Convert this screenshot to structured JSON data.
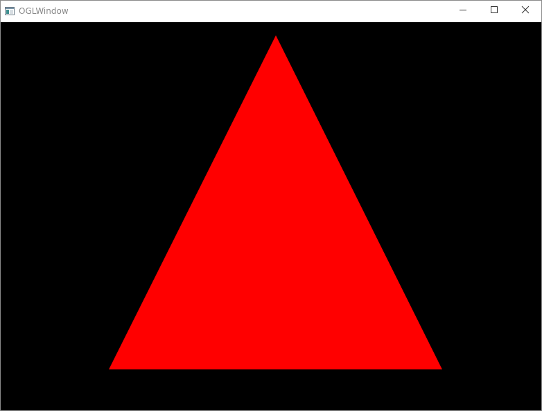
{
  "window": {
    "title": "OGLWindow",
    "icon": "app-window-icon",
    "controls": {
      "minimize_icon": "minimize-icon",
      "maximize_icon": "maximize-icon",
      "close_icon": "close-icon"
    }
  },
  "scene": {
    "background_color": "#000000",
    "shape": "triangle",
    "fill_color": "#ff0000"
  }
}
